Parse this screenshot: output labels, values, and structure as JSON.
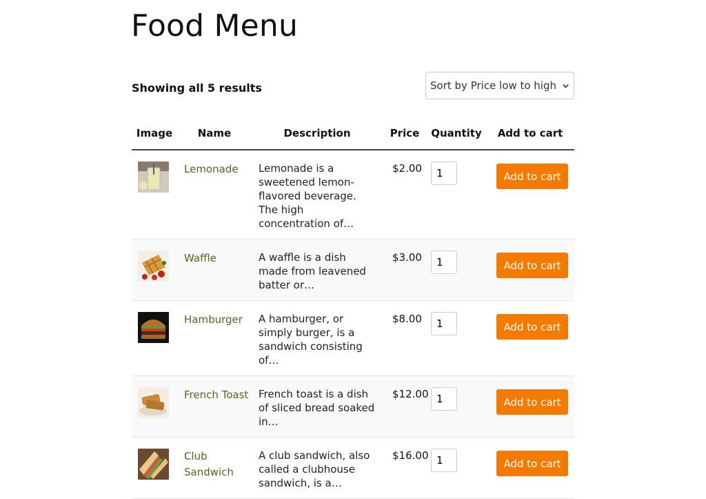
{
  "page": {
    "title": "Food Menu"
  },
  "toolbar": {
    "result_count": "Showing all 5 results",
    "sort": {
      "selected": "Sort by Price low to high",
      "icon": "chevron-down-icon"
    }
  },
  "table": {
    "headers": [
      "Image",
      "Name",
      "Description",
      "Price",
      "Quantity",
      "Add to cart"
    ],
    "rows": [
      {
        "image": "lemonade-thumbnail",
        "name": "Lemonade",
        "description": "Lemonade is a sweetened lemon-flavored beverage. The high concentration of…",
        "price": "$2.00",
        "quantity": "1",
        "button": "Add to cart"
      },
      {
        "image": "waffle-thumbnail",
        "name": "Waffle",
        "description": "A waffle is a dish made from leavened batter or…",
        "price": "$3.00",
        "quantity": "1",
        "button": "Add to cart"
      },
      {
        "image": "hamburger-thumbnail",
        "name": "Hamburger",
        "description": "A hamburger, or simply burger, is a sandwich consisting of…",
        "price": "$8.00",
        "quantity": "1",
        "button": "Add to cart"
      },
      {
        "image": "french-toast-thumbnail",
        "name": "French Toast",
        "description": "French toast is a dish of sliced bread soaked in…",
        "price": "$12.00",
        "quantity": "1",
        "button": "Add to cart"
      },
      {
        "image": "club-sandwich-thumbnail",
        "name": "Club Sandwich",
        "description": "A club sandwich, also called a clubhouse sandwich, is a…",
        "price": "$16.00",
        "quantity": "1",
        "button": "Add to cart"
      }
    ]
  },
  "colors": {
    "accent": "#f47b00",
    "link": "#4b6b23"
  }
}
